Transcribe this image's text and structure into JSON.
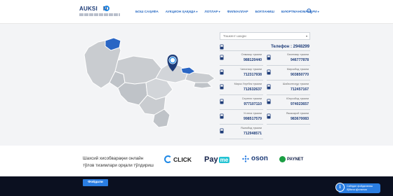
{
  "header": {
    "logo_text": "AUKSI",
    "logo_suffix": "N",
    "nav": [
      {
        "label": "БОШ САҲИФА",
        "caret": false
      },
      {
        "label": "АУКЦИОН ҲАҚИДА",
        "caret": true
      },
      {
        "label": "ЛОТЛАР",
        "caret": true
      },
      {
        "label": "ФИЛИАЛЛАР",
        "caret": false
      },
      {
        "label": "БОҒЛАНИШ",
        "caret": false
      },
      {
        "label": "БУЮРТМАНОМАЛАРИ",
        "caret": true
      }
    ],
    "caret_glyph": "▾",
    "search_icon": "search-icon"
  },
  "region_select": {
    "value": "Тошкент шаҳри",
    "arrow": "▾"
  },
  "phone": {
    "label": "Телефон : 2948299"
  },
  "districts": [
    {
      "name": "Олмазор тумани",
      "number": "988120440"
    },
    {
      "name": "Бектемир тумани",
      "number": "946777878"
    },
    {
      "name": "Чилонзор тумани",
      "number": "712317938"
    },
    {
      "name": "Мирзобод тумани",
      "number": "903850770"
    },
    {
      "name": "Мирзо Улуғбек тумани",
      "number": "712632637"
    },
    {
      "name": "Шайхонтоҳур тумани",
      "number": "712457167"
    },
    {
      "name": "Сергели тумани",
      "number": "977107110"
    },
    {
      "name": "Юнусобод тумани",
      "number": "974023657"
    },
    {
      "name": "Учтепа тумани",
      "number": "998517579"
    },
    {
      "name": "Яккасарой тумани",
      "number": "983670083"
    },
    {
      "name": "Яшнобод тумани",
      "number": "712948571"
    }
  ],
  "payment": {
    "text_line1": "Шахсий хисобварақни онлайн",
    "text_line2": "тўлов тизимлари орқали тўлдириш",
    "click": "CLICK",
    "payme_a": "Pay",
    "payme_b": "me",
    "oson": "oson",
    "paynet": "PAYNET"
  },
  "footer": {
    "useful_button": "Фойдали",
    "chat_line1": "Сайтдан фойдаланиш",
    "chat_line2": "бўйича қўлланма"
  },
  "colors": {
    "brand_blue": "#2b6cc4",
    "dark_navy": "#1e3c78",
    "map_region": "#c9ccd0",
    "map_highlight": "#2a66c4",
    "footer": "#0b1020"
  }
}
